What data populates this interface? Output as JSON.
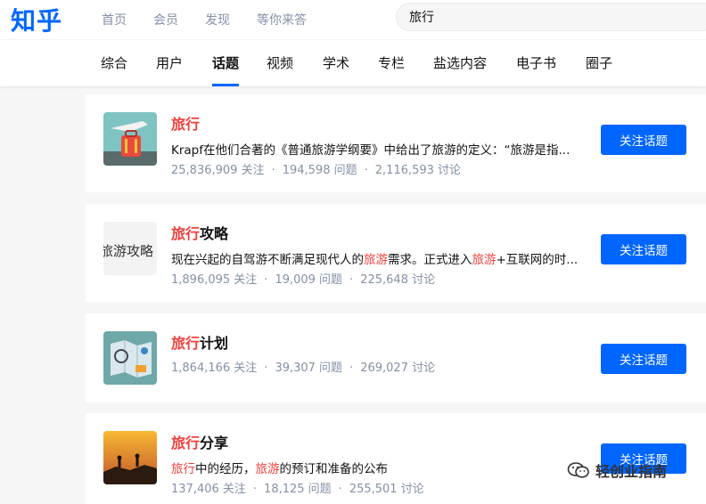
{
  "header": {
    "logo": "知乎",
    "nav": [
      "首页",
      "会员",
      "发现",
      "等你来答"
    ],
    "search_value": "旅行"
  },
  "tabs": [
    "综合",
    "用户",
    "话题",
    "视频",
    "学术",
    "专栏",
    "盐选内容",
    "电子书",
    "圈子"
  ],
  "active_tab": "话题",
  "cards": [
    {
      "title_hl": "旅行",
      "title_rest": "",
      "desc_segments": [
        {
          "text": "Krapf在他们合著的《普通旅游学纲要》中给出了旅游的定义：“旅游是指...",
          "hl": false
        }
      ],
      "followers": "25,836,909 关注",
      "questions": "194,598 问题",
      "discussions": "2,116,593 讨论",
      "button": "关注话题"
    },
    {
      "title_hl": "旅行",
      "title_rest": "攻略",
      "thumb_text": "旅游攻略",
      "desc_segments": [
        {
          "text": "现在兴起的自驾游不断满足现代人的",
          "hl": false
        },
        {
          "text": "旅游",
          "hl": true
        },
        {
          "text": "需求。正式进入",
          "hl": false
        },
        {
          "text": "旅游",
          "hl": true
        },
        {
          "text": "+互联网的时...",
          "hl": false
        }
      ],
      "followers": "1,896,095 关注",
      "questions": "19,009 问题",
      "discussions": "225,648 讨论",
      "button": "关注话题"
    },
    {
      "title_hl": "旅行",
      "title_rest": "计划",
      "desc_segments": [],
      "followers": "1,864,166 关注",
      "questions": "39,307 问题",
      "discussions": "269,027 讨论",
      "button": "关注话题"
    },
    {
      "title_hl": "旅行",
      "title_rest": "分享",
      "desc_segments": [
        {
          "text": "旅行",
          "hl": true
        },
        {
          "text": "中的经历，",
          "hl": false
        },
        {
          "text": "旅游",
          "hl": true
        },
        {
          "text": "的预订和准备的公布",
          "hl": false
        }
      ],
      "followers": "137,406 关注",
      "questions": "18,125 问题",
      "discussions": "255,501 讨论",
      "button": "关注话题"
    }
  ],
  "watermark": "轻创业指南",
  "colors": {
    "accent": "#0066ff",
    "highlight": "#f1403c",
    "meta": "#8590a6"
  }
}
